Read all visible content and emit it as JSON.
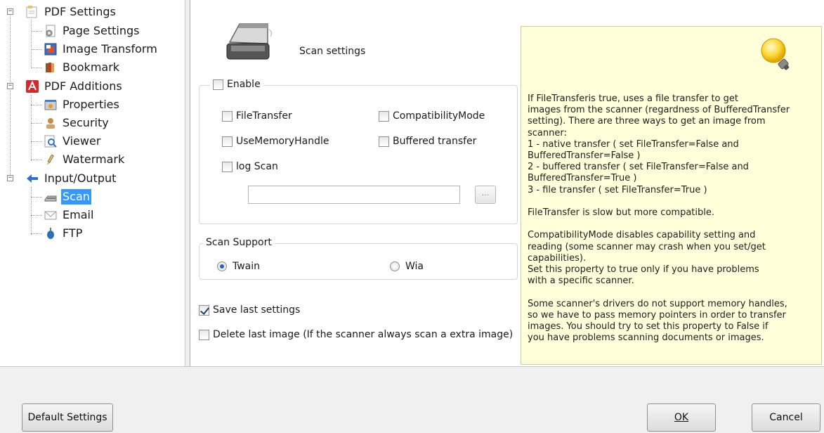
{
  "tree": {
    "pdf_settings": "PDF Settings",
    "page_settings": "Page Settings",
    "image_transform": "Image Transform",
    "bookmark": "Bookmark",
    "pdf_additions": "PDF Additions",
    "properties": "Properties",
    "security": "Security",
    "viewer": "Viewer",
    "watermark": "Watermark",
    "input_output": "Input/Output",
    "scan": "Scan",
    "email": "Email",
    "ftp": "FTP"
  },
  "scan": {
    "title": "Scan settings",
    "enable_label": "Enable",
    "enable_checked": false,
    "file_transfer": "FileTransfer",
    "compatibility_mode": "CompatibilityMode",
    "use_memory_handle": "UseMemoryHandle",
    "buffered_transfer": "Buffered transfer",
    "log_scan": "log Scan",
    "log_path_value": "",
    "browse_label": "...",
    "support_title": "Scan Support",
    "twain": "Twain",
    "wia": "Wia",
    "selected_support": "Twain",
    "save_last": "Save last settings",
    "save_last_checked": true,
    "delete_last": "Delete last image (If the scanner always scan a extra image)"
  },
  "note": {
    "text": "If FileTransferis true, uses a file transfer to get\nimages from the scanner (regardness of BufferedTransfer\nsetting). There are three ways to get an image from\nscanner:\n1 - native transfer ( set FileTransfer=False and\nBufferedTransfer=False )\n2 - buffered transfer ( set FileTransfer=False and\nBufferedTransfer=True )\n3 - file transfer ( set FileTransfer=True )\n\nFileTransfer is slow but more compatible.\n\nCompatibilityMode disables capability setting and\nreading (some scanner may crash when you set/get\ncapabilities).\nSet this property to true only if you have problems\nwith a specific scanner.\n\nSome scanner's drivers do not support memory handles,\nso we have to pass memory pointers in order to transfer\nimages. You should try to set this property to False if\nyou have problems scanning documents or images."
  },
  "buttons": {
    "default_settings": "Default Settings",
    "ok": "OK",
    "cancel": "Cancel"
  },
  "colors": {
    "selection": "#3399ff",
    "note_bg": "#ffffd9"
  }
}
